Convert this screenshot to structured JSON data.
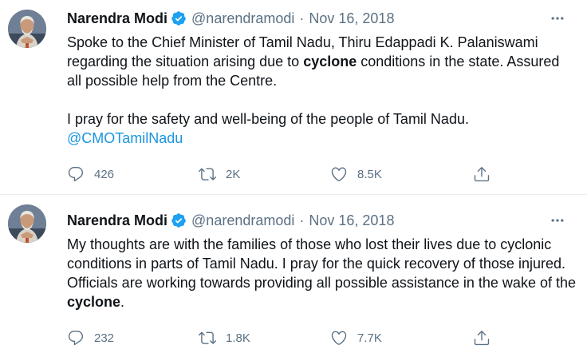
{
  "tweets": [
    {
      "author_name": "Narendra Modi",
      "handle": "@narendramodi",
      "separator": "·",
      "date": "Nov 16, 2018",
      "text": {
        "p1_before": "Spoke to the Chief Minister of Tamil Nadu, Thiru Edappadi K. Palaniswami regarding the situation arising due to ",
        "p1_bold": "cyclone",
        "p1_after": " conditions in the state. Assured all possible help from the Centre.",
        "p2": "I pray for the safety and well-being of the people of Tamil Nadu.",
        "mention": "@CMOTamilNadu"
      },
      "stats": {
        "replies": "426",
        "retweets": "2K",
        "likes": "8.5K"
      }
    },
    {
      "author_name": "Narendra Modi",
      "handle": "@narendramodi",
      "separator": "·",
      "date": "Nov 16, 2018",
      "text": {
        "p1_before": "My thoughts are with the families of those who lost their lives due to cyclonic conditions in parts of Tamil Nadu. I pray for the quick recovery of those injured. Officials are working towards providing all possible assistance in the wake of the ",
        "p1_bold": "cyclone",
        "p1_after": "."
      },
      "stats": {
        "replies": "232",
        "retweets": "1.8K",
        "likes": "7.7K"
      }
    }
  ],
  "colors": {
    "text": "#0f1419",
    "secondary": "#5b7083",
    "link": "#1b95e0",
    "verified": "#1da1f2",
    "divider": "#e6ecf0"
  },
  "icons": [
    "verified-badge-icon",
    "more-icon",
    "reply-icon",
    "retweet-icon",
    "like-icon",
    "share-icon"
  ]
}
